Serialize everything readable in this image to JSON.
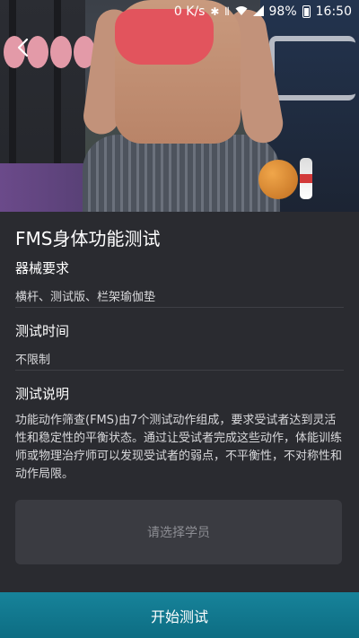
{
  "status_bar": {
    "network_speed": "0 K/s",
    "battery": "98%",
    "time": "16:50"
  },
  "icons": {
    "back": "chevron-left-icon",
    "bluetooth": "bluetooth-icon",
    "vibrate": "vibrate-icon",
    "wifi": "wifi-icon",
    "signal": "signal-icon",
    "battery": "battery-icon"
  },
  "page": {
    "title": "FMS身体功能测试"
  },
  "sections": {
    "equipment": {
      "title": "器械要求",
      "body": "横杆、测试版、栏架瑜伽垫"
    },
    "duration": {
      "title": "测试时间",
      "body": "不限制"
    },
    "description": {
      "title": "测试说明",
      "body": "功能动作筛查(FMS)由7个测试动作组成，要求受试者达到灵活性和稳定性的平衡状态。通过让受试者完成这些动作，体能训练师或物理治疗师可以发现受试者的弱点，不平衡性，不对称性和动作局限。"
    }
  },
  "select_student": {
    "label": "请选择学员"
  },
  "start_button": {
    "label": "开始测试"
  },
  "colors": {
    "background": "#2a2b30",
    "select_box": "#3a3b41",
    "start_button": "#0d7a90",
    "placeholder_text": "#8c8d93"
  }
}
